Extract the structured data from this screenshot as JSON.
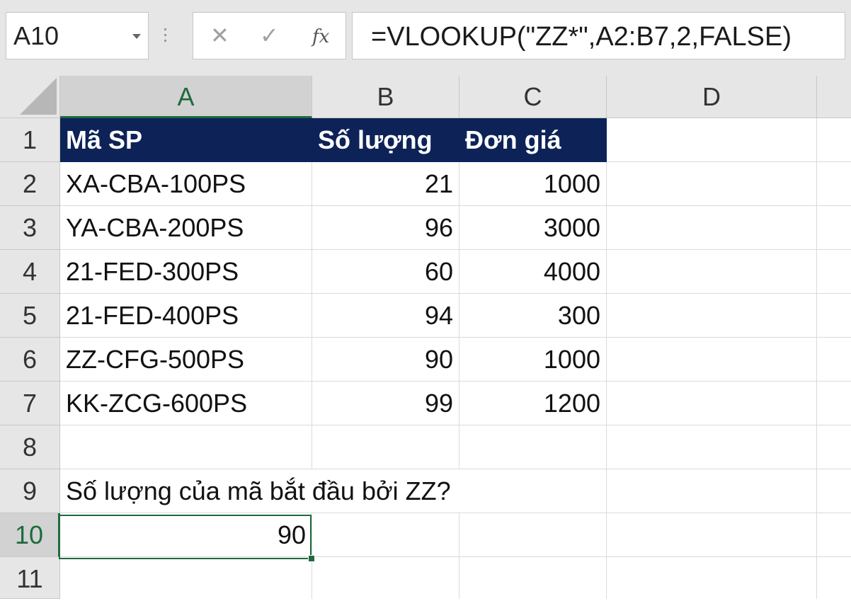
{
  "name_box": {
    "value": "A10"
  },
  "formula_bar": {
    "cancel_glyph": "✕",
    "enter_glyph": "✓",
    "fx_label": "fx",
    "formula": "=VLOOKUP(\"ZZ*\",A2:B7,2,FALSE)"
  },
  "columns": [
    "A",
    "B",
    "C",
    "D"
  ],
  "active_column": "A",
  "rows": [
    "1",
    "2",
    "3",
    "4",
    "5",
    "6",
    "7",
    "8",
    "9",
    "10",
    "11"
  ],
  "active_row": "10",
  "table": {
    "headers": [
      "Mã SP",
      "Số lượng",
      "Đơn giá"
    ],
    "data": [
      [
        "XA-CBA-100PS",
        "21",
        "1000"
      ],
      [
        "YA-CBA-200PS",
        "96",
        "3000"
      ],
      [
        "21-FED-300PS",
        "60",
        "4000"
      ],
      [
        "21-FED-400PS",
        "94",
        "300"
      ],
      [
        "ZZ-CFG-500PS",
        "90",
        "1000"
      ],
      [
        "KK-ZCG-600PS",
        "99",
        "1200"
      ]
    ]
  },
  "question": "Số lượng của mã bắt đầu bởi ZZ?",
  "result": "90",
  "colors": {
    "header_fill": "#0d2358",
    "selection": "#1e6b3c"
  }
}
